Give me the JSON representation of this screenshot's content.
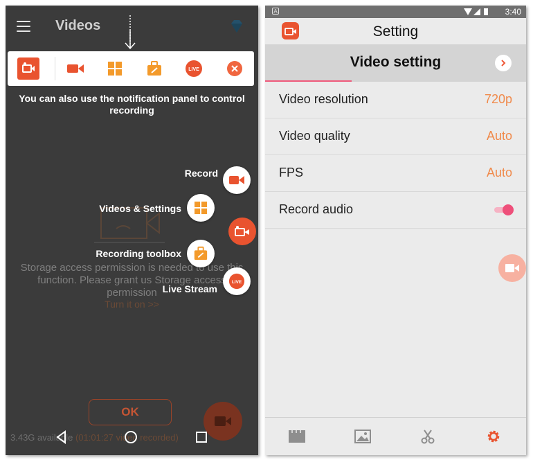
{
  "left": {
    "header": {
      "title": "Videos",
      "menu_icon": "menu-icon",
      "premium_icon": "diamond-icon"
    },
    "toolbar": {
      "items": [
        {
          "name": "screen-recorder-logo-icon"
        },
        {
          "name": "record-icon"
        },
        {
          "name": "videos-grid-icon"
        },
        {
          "name": "toolbox-icon"
        },
        {
          "name": "live-icon",
          "text": "LIVE"
        },
        {
          "name": "close-icon"
        }
      ]
    },
    "notice": "You can also use the notification panel to control recording",
    "fab_menu": {
      "record": "Record",
      "videos_settings": "Videos & Settings",
      "toolbox": "Recording toolbox",
      "live": "Live Stream",
      "live_badge": "LIVE"
    },
    "background_message": "Storage access permission is needed to use this function. Please grant us Storage access permission",
    "background_link": "Turn it on >>",
    "ok_button": "OK",
    "storage": {
      "available": "3.43G available",
      "recorded": "(01:01:27 video recorded)"
    },
    "colors": {
      "accent": "#e9532f",
      "background": "#3b3b3b"
    }
  },
  "right": {
    "status_bar": {
      "time": "3:40",
      "notification_badge": "A"
    },
    "app_bar": {
      "title": "Setting"
    },
    "section": {
      "title": "Video setting"
    },
    "rows": [
      {
        "label": "Video resolution",
        "value": "720p"
      },
      {
        "label": "Video quality",
        "value": "Auto"
      },
      {
        "label": "FPS",
        "value": "Auto"
      },
      {
        "label": "Record audio",
        "toggle": true
      }
    ],
    "bottom_nav": [
      {
        "name": "videos-tab",
        "icon": "film-icon"
      },
      {
        "name": "images-tab",
        "icon": "image-icon"
      },
      {
        "name": "edit-tab",
        "icon": "scissors-icon"
      },
      {
        "name": "settings-tab",
        "icon": "gear-icon",
        "active": true
      }
    ],
    "colors": {
      "accent": "#f08a4b",
      "toggle": "#ee4f7a",
      "active_tab": "#e9532f"
    }
  }
}
